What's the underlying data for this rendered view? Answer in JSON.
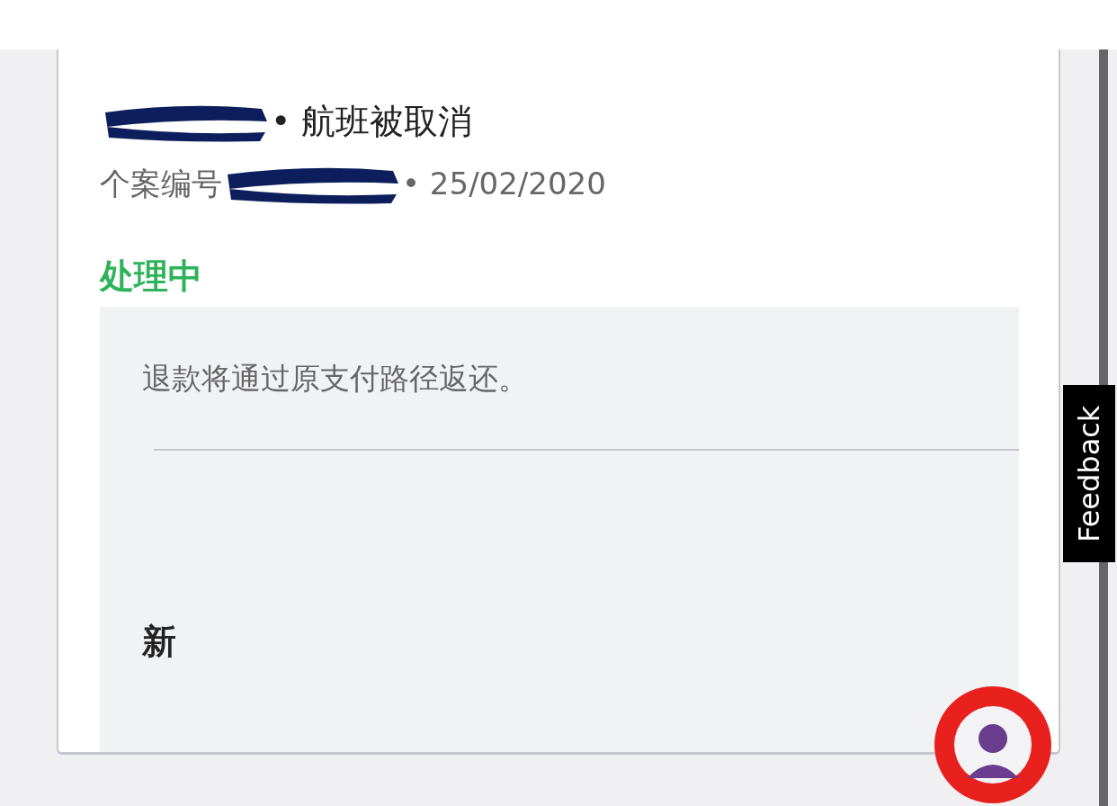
{
  "case": {
    "title": "• 航班被取消",
    "number_label": "个案编号",
    "date": "• 25/02/2020"
  },
  "status": {
    "label": "处理中"
  },
  "message": {
    "text": "退款将通过原支付路径返还。"
  },
  "update": {
    "label": "新"
  },
  "feedback": {
    "label": "Feedback"
  }
}
